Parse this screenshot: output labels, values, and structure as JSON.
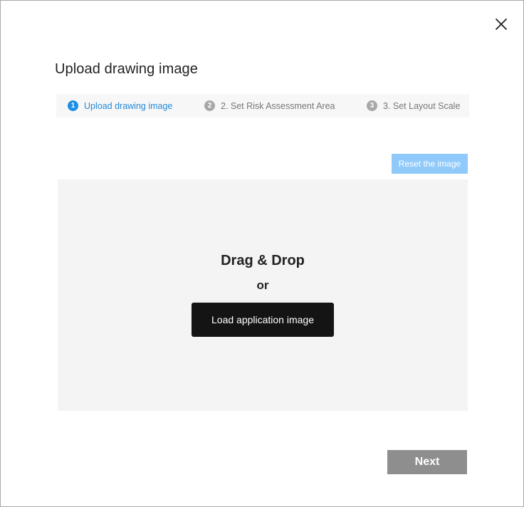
{
  "dialog": {
    "title": "Upload drawing image",
    "close_icon": "close-icon"
  },
  "steps": [
    {
      "number": "1",
      "label": "Upload drawing image",
      "state": "active"
    },
    {
      "number": "2",
      "label": "2. Set Risk Assessment Area",
      "state": "inactive"
    },
    {
      "number": "3",
      "label": "3. Set Layout Scale",
      "state": "inactive"
    }
  ],
  "toolbar": {
    "reset_label": "Reset the image"
  },
  "dropzone": {
    "title": "Drag & Drop",
    "or_text": "or",
    "load_label": "Load application image"
  },
  "footer": {
    "next_label": "Next"
  },
  "colors": {
    "accent": "#1d8fe6",
    "reset_button": "#8fcafb",
    "load_button": "#141414",
    "next_button": "#8e8e8e",
    "dropzone_bg": "#f4f4f4"
  }
}
